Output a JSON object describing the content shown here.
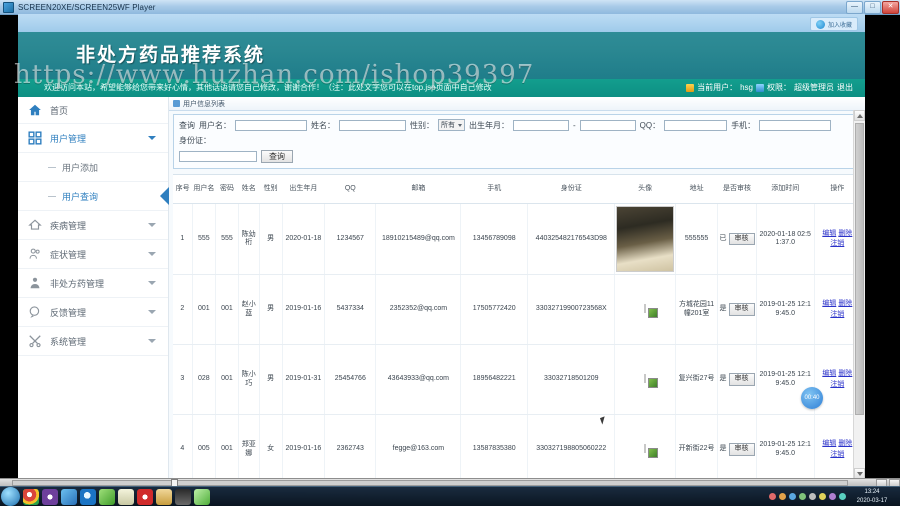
{
  "window": {
    "title": "SCREEN20XE/SCREEN25WF Player",
    "minimize": "—",
    "maximize": "□",
    "close": "✕"
  },
  "browser": {
    "action_button_label": "加入收藏"
  },
  "header": {
    "system_title": "非处方药品推荐系统",
    "welcome_text": "欢迎访问本站，希望能够给您带来好心情，其他话语请您自己修改，谢谢合作！（注：此处文字您可以在top.jsp页面中自己修改",
    "current_user_label": "当前用户：",
    "current_user": "hsg",
    "role_label": "权限：",
    "role": "超级管理员",
    "logout": "退出"
  },
  "sidebar": {
    "home": "首页",
    "items": [
      {
        "label": "用户管理",
        "icon": "grid-icon",
        "expanded": true,
        "children": [
          {
            "label": "用户添加",
            "selected": false
          },
          {
            "label": "用户查询",
            "selected": true
          }
        ]
      },
      {
        "label": "疾病管理",
        "icon": "home-icon",
        "expanded": false
      },
      {
        "label": "症状管理",
        "icon": "people-icon",
        "expanded": false
      },
      {
        "label": "非处方药管理",
        "icon": "person-icon",
        "expanded": false
      },
      {
        "label": "反馈管理",
        "icon": "chat-icon",
        "expanded": false
      },
      {
        "label": "系统管理",
        "icon": "tools-icon",
        "expanded": false
      }
    ]
  },
  "content": {
    "tab_label": "用户信息列表",
    "filter": {
      "prefix": "查询",
      "username_label": "用户名：",
      "username_value": "",
      "name_label": "姓名：",
      "name_value": "",
      "gender_label": "性别：",
      "gender_value": "所有",
      "birth_label": "出生年月：",
      "birth_from": "",
      "birth_sep": "-",
      "birth_to": "",
      "qq_label": "QQ：",
      "qq_value": "",
      "phone_label": "手机：",
      "phone_value": "",
      "idcard_label": "身份证：",
      "idcard_value": "",
      "search_button": "查询"
    },
    "table": {
      "columns": [
        "序号",
        "用户名",
        "密码",
        "姓名",
        "性别",
        "出生年月",
        "QQ",
        "邮箱",
        "手机",
        "身份证",
        "头像",
        "地址",
        "是否审核",
        "添加时间",
        "操作"
      ],
      "audit_button": "审核",
      "op_edit": "编辑",
      "op_delete": "删除",
      "op_logout": "注销",
      "rows": [
        {
          "index": "1",
          "username": "555",
          "password": "555",
          "name": "陈幼桁",
          "gender": "男",
          "birth": "2020-01-18",
          "qq": "1234567",
          "email": "18910215489@qq.com",
          "phone": "13456789098",
          "idcard": "440325482176543D98",
          "avatar": "photo",
          "address": "555555",
          "audited": "已",
          "created": "2020-01-18 02:51:37.0"
        },
        {
          "index": "2",
          "username": "001",
          "password": "001",
          "name": "赵小蓝",
          "gender": "男",
          "birth": "2019-01-16",
          "qq": "5437334",
          "email": "2352352@qq.com",
          "phone": "17505772420",
          "idcard": "33032719900723568X",
          "avatar": "broken",
          "address": "方城花园11幢201室",
          "audited": "是",
          "created": "2019-01-25 12:19:45.0"
        },
        {
          "index": "3",
          "username": "028",
          "password": "001",
          "name": "陈小巧",
          "gender": "男",
          "birth": "2019-01-31",
          "qq": "25454766",
          "email": "43643933@qq.com",
          "phone": "18956482221",
          "idcard": "33032718501209",
          "avatar": "broken",
          "address": "复兴街27号",
          "audited": "是",
          "created": "2019-01-25 12:19:45.0"
        },
        {
          "index": "4",
          "username": "005",
          "password": "001",
          "name": "郑亚娜",
          "gender": "女",
          "birth": "2019-01-16",
          "qq": "2362743",
          "email": "fegge@163.com",
          "phone": "13587835380",
          "idcard": "330327198805060222",
          "avatar": "broken",
          "address": "开新街22号",
          "audited": "是",
          "created": "2019-01-25 12:19:45.0"
        }
      ]
    }
  },
  "overlay": {
    "watermark": "https://www.huzhan.com/ishop39397",
    "video_time_badge": "00:40"
  },
  "taskbar": {
    "clock_time": "13:24",
    "clock_date": "2020-03-17"
  }
}
